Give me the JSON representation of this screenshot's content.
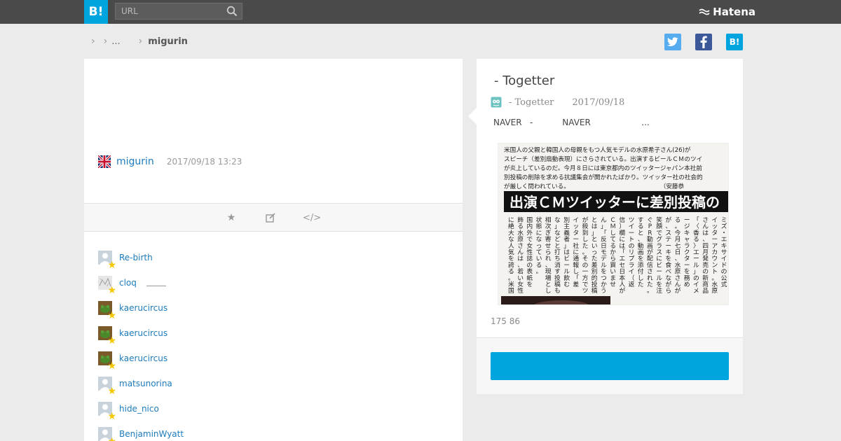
{
  "header": {
    "logo_text": "B!",
    "search_placeholder": "URL",
    "brand_text": "Hatena"
  },
  "breadcrumb": {
    "ellipsis": "...",
    "current": "migurin"
  },
  "share": {
    "hatena_label": "B!"
  },
  "comment": {
    "user": "migurin",
    "datetime": "2017/09/18 13:23"
  },
  "stars": [
    {
      "name": "Re-birth",
      "note": ""
    },
    {
      "name": "cloq",
      "note": ""
    },
    {
      "name": "kaerucircus",
      "note": ""
    },
    {
      "name": "kaerucircus",
      "note": ""
    },
    {
      "name": "kaerucircus",
      "note": ""
    },
    {
      "name": "matsunorina",
      "note": ""
    },
    {
      "name": "hide_nico",
      "note": ""
    },
    {
      "name": "BenjaminWyatt",
      "note": ""
    }
  ],
  "entry": {
    "title": " - Togetter",
    "source": " - Togetter",
    "date": "2017/09/18",
    "summary": "NAVER   -           NAVER                   ...",
    "counts": "175 86",
    "bookmark_label": ""
  },
  "thumbnail": {
    "lead_lines": [
      "米国人の父親と韓国人の母親をもつ人気モデルの水原希子さん(26)が",
      "スピーチ（差別扇動表現）にさらされている。出演するビールＣＭのツイ",
      "が炎上しているのだ。今月８日には東京都内のツイッタージャパン本社前",
      "別投稿の削除を求める抗議集会が開かれたばかり。ツイッター社の社会的",
      "が厳しく問われている。　　　　　　　　　　　　　　　　（安藤恭"
    ],
    "headline": "出演ＣＭツイッターに差別投稿の",
    "columns": [
      "ミズ・エキサイドの公式",
      "イッターアカウント。水原",
      "さんは、四月発売の新商品",
      "「〈香る〉エール」のイメ",
      "ージキャラクターを務め",
      "る。今月七日、水原さんが",
      "が、ステーキを食べながら",
      "笑顔でグラスにビールを注",
      "ぐPR動画が配信された。",
      "すると、動画を添付した",
      "ツイートのリプライ（返",
      "信）欄には「エセ日本人が",
      "ＣＭしてるから買いませ",
      "ん」「反日モデルをつかう",
      "とは」といった差別的投稿",
      "が殺到した。その一方でツ",
      "イッター社に通報し「差",
      "別主義者」はビール飲む",
      "な」などと打ち消す投稿も",
      "相次ぎ寄せられ、現場とした",
      "状態になっている。",
      "国内外で女性誌の表紙を",
      "飾る水原さんは、若い女性",
      "に絶大な人気を誇る。米国"
    ]
  },
  "colors": {
    "topbar": "#4a4a4a",
    "brand_blue": "#00a4de",
    "link": "#1c7bbd",
    "star": "#f5c700",
    "twitter": "#55acee",
    "facebook": "#3b5998"
  }
}
